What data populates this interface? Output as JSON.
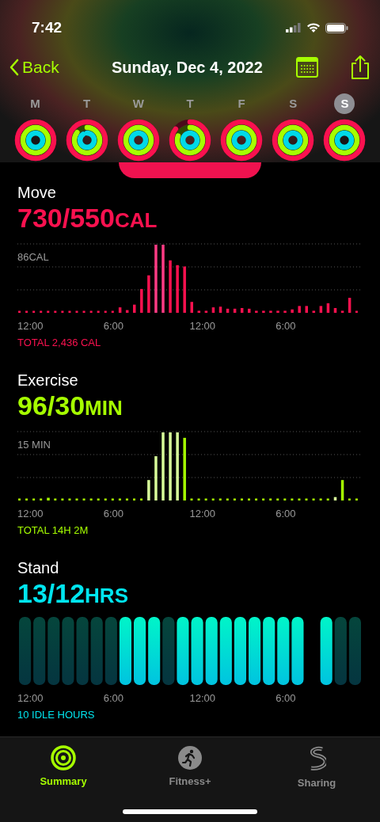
{
  "status_bar": {
    "time": "7:42"
  },
  "nav": {
    "back": "Back",
    "title": "Sunday, Dec 4, 2022"
  },
  "week": [
    {
      "day": "M",
      "selected": false
    },
    {
      "day": "T",
      "selected": false
    },
    {
      "day": "W",
      "selected": false
    },
    {
      "day": "T",
      "selected": false
    },
    {
      "day": "F",
      "selected": false
    },
    {
      "day": "S",
      "selected": false
    },
    {
      "day": "S",
      "selected": true
    }
  ],
  "sections": [
    {
      "kind": "calories",
      "title": "Move",
      "value": "730/550",
      "unit": "CAL",
      "color": "#fa114f",
      "scale_label": "86CAL",
      "axis": [
        "12:00",
        "6:00",
        "12:00",
        "6:00"
      ],
      "total": "TOTAL 2,436 CAL"
    },
    {
      "kind": "minutes",
      "title": "Exercise",
      "value": "96/30",
      "unit": "MIN",
      "color": "#a6ff00",
      "scale_label": "15 MIN",
      "axis": [
        "12:00",
        "6:00",
        "12:00",
        "6:00"
      ],
      "total": "TOTAL 14H 2M"
    },
    {
      "kind": "hours",
      "title": "Stand",
      "value": "13/12",
      "unit": "HRS",
      "color": "#00e5ef",
      "axis": [
        "12:00",
        "6:00",
        "12:00",
        "6:00"
      ],
      "total": "10 IDLE HOURS"
    }
  ],
  "tabs": [
    {
      "label": "Summary",
      "kind": "rings",
      "selected": true
    },
    {
      "label": "Fitness+",
      "kind": "runner",
      "selected": false
    },
    {
      "label": "Sharing",
      "kind": "sharing",
      "selected": false
    }
  ]
}
